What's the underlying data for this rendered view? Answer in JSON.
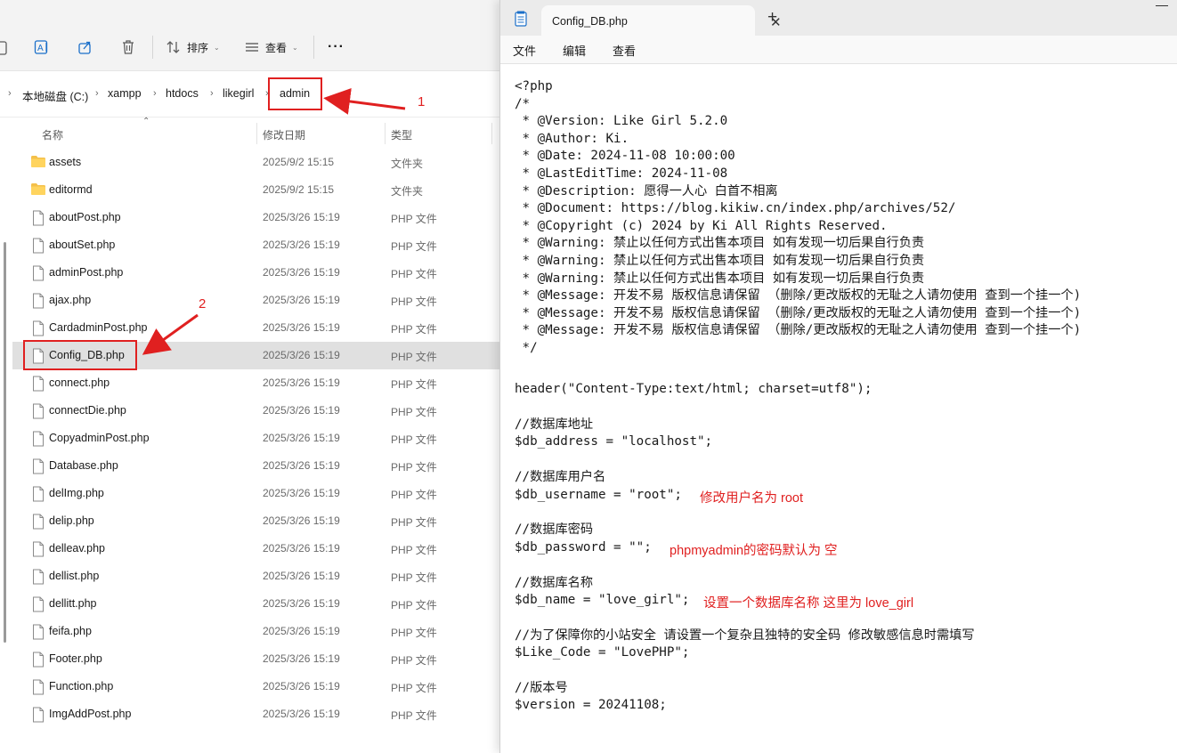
{
  "explorer": {
    "toolbar": {
      "sort_label": "排序",
      "view_label": "查看",
      "more_label": "···"
    },
    "breadcrumb": [
      "本地磁盘 (C:)",
      "xampp",
      "htdocs",
      "likegirl",
      "admin"
    ],
    "columns": {
      "name": "名称",
      "modified": "修改日期",
      "type": "类型"
    },
    "files": [
      {
        "name": "assets",
        "modified": "2025/9/2 15:15",
        "type": "文件夹",
        "kind": "folder"
      },
      {
        "name": "editormd",
        "modified": "2025/9/2 15:15",
        "type": "文件夹",
        "kind": "folder"
      },
      {
        "name": "aboutPost.php",
        "modified": "2025/3/26 15:19",
        "type": "PHP 文件",
        "kind": "file"
      },
      {
        "name": "aboutSet.php",
        "modified": "2025/3/26 15:19",
        "type": "PHP 文件",
        "kind": "file"
      },
      {
        "name": "adminPost.php",
        "modified": "2025/3/26 15:19",
        "type": "PHP 文件",
        "kind": "file"
      },
      {
        "name": "ajax.php",
        "modified": "2025/3/26 15:19",
        "type": "PHP 文件",
        "kind": "file"
      },
      {
        "name": "CardadminPost.php",
        "modified": "2025/3/26 15:19",
        "type": "PHP 文件",
        "kind": "file"
      },
      {
        "name": "Config_DB.php",
        "modified": "2025/3/26 15:19",
        "type": "PHP 文件",
        "kind": "file",
        "selected": true
      },
      {
        "name": "connect.php",
        "modified": "2025/3/26 15:19",
        "type": "PHP 文件",
        "kind": "file"
      },
      {
        "name": "connectDie.php",
        "modified": "2025/3/26 15:19",
        "type": "PHP 文件",
        "kind": "file"
      },
      {
        "name": "CopyadminPost.php",
        "modified": "2025/3/26 15:19",
        "type": "PHP 文件",
        "kind": "file"
      },
      {
        "name": "Database.php",
        "modified": "2025/3/26 15:19",
        "type": "PHP 文件",
        "kind": "file"
      },
      {
        "name": "delImg.php",
        "modified": "2025/3/26 15:19",
        "type": "PHP 文件",
        "kind": "file"
      },
      {
        "name": "delip.php",
        "modified": "2025/3/26 15:19",
        "type": "PHP 文件",
        "kind": "file"
      },
      {
        "name": "delleav.php",
        "modified": "2025/3/26 15:19",
        "type": "PHP 文件",
        "kind": "file"
      },
      {
        "name": "dellist.php",
        "modified": "2025/3/26 15:19",
        "type": "PHP 文件",
        "kind": "file"
      },
      {
        "name": "dellitt.php",
        "modified": "2025/3/26 15:19",
        "type": "PHP 文件",
        "kind": "file"
      },
      {
        "name": "feifa.php",
        "modified": "2025/3/26 15:19",
        "type": "PHP 文件",
        "kind": "file"
      },
      {
        "name": "Footer.php",
        "modified": "2025/3/26 15:19",
        "type": "PHP 文件",
        "kind": "file"
      },
      {
        "name": "Function.php",
        "modified": "2025/3/26 15:19",
        "type": "PHP 文件",
        "kind": "file"
      },
      {
        "name": "ImgAddPost.php",
        "modified": "2025/3/26 15:19",
        "type": "PHP 文件",
        "kind": "file"
      }
    ]
  },
  "annotations": {
    "step1": "1",
    "step2": "2",
    "color": "#e02020"
  },
  "notepad": {
    "tab_title": "Config_DB.php",
    "menu": [
      "文件",
      "编辑",
      "查看"
    ],
    "code_header": [
      "<?php",
      "/*",
      " * @Version: Like Girl 5.2.0",
      " * @Author: Ki.",
      " * @Date: 2024-11-08 10:00:00",
      " * @LastEditTime: 2024-11-08",
      " * @Description: 愿得一人心 白首不相离",
      " * @Document: https://blog.kikiw.cn/index.php/archives/52/",
      " * @Copyright (c) 2024 by Ki All Rights Reserved.",
      " * @Warning: 禁止以任何方式出售本项目 如有发现一切后果自行负责",
      " * @Warning: 禁止以任何方式出售本项目 如有发现一切后果自行负责",
      " * @Warning: 禁止以任何方式出售本项目 如有发现一切后果自行负责",
      " * @Message: 开发不易 版权信息请保留 （删除/更改版权的无耻之人请勿使用 查到一个挂一个)",
      " * @Message: 开发不易 版权信息请保留 （删除/更改版权的无耻之人请勿使用 查到一个挂一个)",
      " * @Message: 开发不易 版权信息请保留 （删除/更改版权的无耻之人请勿使用 查到一个挂一个)",
      " */"
    ],
    "header_call": "header(\"Content-Type:text/html; charset=utf8\");",
    "address_comment": "//数据库地址",
    "address_line": "$db_address = \"localhost\";",
    "username_comment": "//数据库用户名",
    "username_line": "$db_username = \"root\";",
    "username_note": "修改用户名为 root",
    "password_comment": "//数据库密码",
    "password_line": "$db_password = \"\";",
    "password_note": "phpmyadmin的密码默认为 空",
    "name_comment": "//数据库名称",
    "name_line": "$db_name = \"love_girl\";",
    "name_note": "设置一个数据库名称  这里为 love_girl",
    "code_comment": "//为了保障你的小站安全 请设置一个复杂且独特的安全码 修改敏感信息时需填写",
    "code_line": "$Like_Code = \"LovePHP\";",
    "version_comment": "//版本号",
    "version_line": "$version = 20241108;"
  }
}
